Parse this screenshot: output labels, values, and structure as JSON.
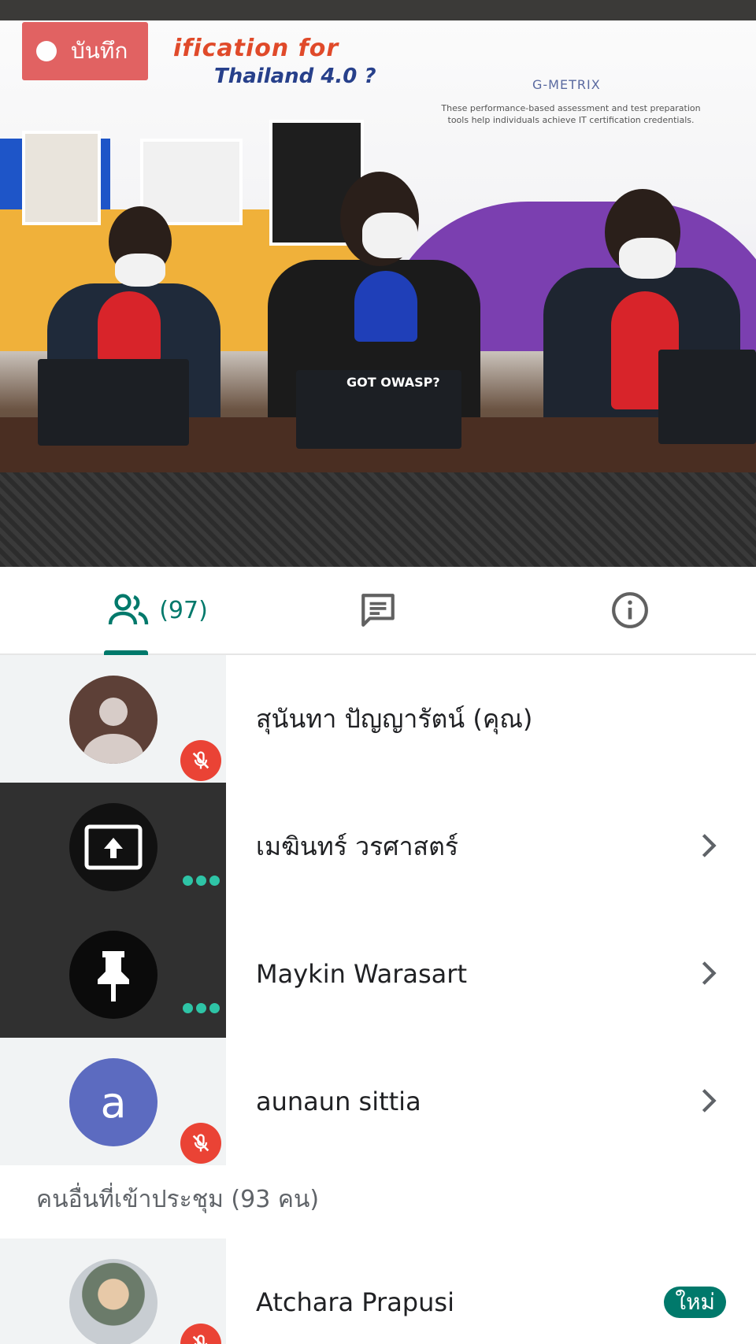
{
  "recording": {
    "label": "บันทึก"
  },
  "video": {
    "banner_headline_1": "ification for",
    "banner_headline_2": "Thailand 4.0 ?",
    "banner_brand": "G-METRIX",
    "banner_caption": "These performance-based assessment and test preparation tools help individuals achieve IT certification credentials.",
    "laptop_sticker": "GOT OWASP?"
  },
  "tabs": {
    "people_count": "(97)",
    "people_icon": "people-icon",
    "chat_icon": "chat-icon",
    "info_icon": "info-icon",
    "active": "people"
  },
  "participants": [
    {
      "name": "สุนันทา ปัญญารัตน์ (คุณ)",
      "avatar": "person-placeholder",
      "muted": true,
      "tile": "light",
      "chevron": false
    },
    {
      "name": "เมฆินทร์ วรศาสตร์",
      "avatar": "present-screen-icon",
      "speaking": true,
      "tile": "dark",
      "chevron": true
    },
    {
      "name": "Maykin Warasart",
      "avatar": "pin-icon",
      "speaking": true,
      "tile": "dark",
      "chevron": true
    },
    {
      "name": "aunaun sittia",
      "avatar_letter": "a",
      "avatar_color": "#5c6bc0",
      "muted": true,
      "tile": "light",
      "chevron": true
    }
  ],
  "others_section": {
    "label": "คนอื่นที่เข้าประชุม (93 คน)"
  },
  "others": [
    {
      "name": "Atchara Prapusi",
      "badge": "ใหม่",
      "muted": true
    }
  ],
  "colors": {
    "accent": "#00796b",
    "mute": "#ea4335",
    "speaking": "#2ec4a6",
    "record": "#e05a5a"
  }
}
